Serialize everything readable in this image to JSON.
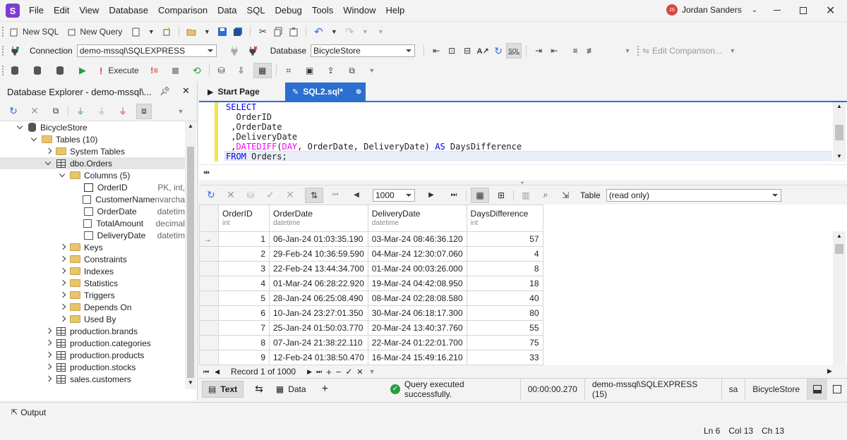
{
  "app": {
    "logo_letter": "S",
    "menu": [
      "File",
      "Edit",
      "View",
      "Database",
      "Comparison",
      "Data",
      "SQL",
      "Debug",
      "Tools",
      "Window",
      "Help"
    ],
    "user": {
      "initials": "JS",
      "name": "Jordan Sanders"
    },
    "accent": "#2c6fce",
    "brand": "#7e3dd1"
  },
  "toolbar": {
    "new_sql": "New SQL",
    "new_query": "New Query",
    "connection_label": "Connection",
    "connection_value": "demo-mssql\\SQLEXPRESS",
    "database_label": "Database",
    "database_value": "BicycleStore",
    "edit_comparison": "Edit Comparison...",
    "execute": "Execute"
  },
  "explorer": {
    "title": "Database Explorer - demo-mssql\\...",
    "tree": [
      {
        "label": "BicycleStore",
        "icon": "database-icon",
        "level": 0,
        "state": "e"
      },
      {
        "label": "Tables (10)",
        "icon": "folder-icon",
        "level": 1,
        "state": "e"
      },
      {
        "label": "System Tables",
        "icon": "folder-icon",
        "level": 2,
        "state": "c"
      },
      {
        "label": "dbo.Orders",
        "icon": "table-icon",
        "level": 2,
        "state": "e",
        "selected": true
      },
      {
        "label": "Columns (5)",
        "icon": "folder-icon",
        "level": 3,
        "state": "e"
      },
      {
        "label": "OrderID",
        "icon": "key-column-icon",
        "level": 4,
        "state": "",
        "type": "PK, int,"
      },
      {
        "label": "CustomerName",
        "icon": "column-icon",
        "level": 4,
        "state": "",
        "type": "nvarcha"
      },
      {
        "label": "OrderDate",
        "icon": "column-icon",
        "level": 4,
        "state": "",
        "type": "datetim"
      },
      {
        "label": "TotalAmount",
        "icon": "column-icon",
        "level": 4,
        "state": "",
        "type": "decimal"
      },
      {
        "label": "DeliveryDate",
        "icon": "column-icon",
        "level": 4,
        "state": "",
        "type": "datetim"
      },
      {
        "label": "Keys",
        "icon": "folder-icon",
        "level": 3,
        "state": "c"
      },
      {
        "label": "Constraints",
        "icon": "folder-icon",
        "level": 3,
        "state": "c"
      },
      {
        "label": "Indexes",
        "icon": "folder-icon",
        "level": 3,
        "state": "c"
      },
      {
        "label": "Statistics",
        "icon": "folder-icon",
        "level": 3,
        "state": "c"
      },
      {
        "label": "Triggers",
        "icon": "folder-icon",
        "level": 3,
        "state": "c"
      },
      {
        "label": "Depends On",
        "icon": "folder-icon",
        "level": 3,
        "state": "c"
      },
      {
        "label": "Used By",
        "icon": "folder-icon",
        "level": 3,
        "state": "c"
      },
      {
        "label": "production.brands",
        "icon": "table-icon",
        "level": 2,
        "state": "c"
      },
      {
        "label": "production.categories",
        "icon": "table-icon",
        "level": 2,
        "state": "c"
      },
      {
        "label": "production.products",
        "icon": "table-icon",
        "level": 2,
        "state": "c"
      },
      {
        "label": "production.stocks",
        "icon": "table-icon",
        "level": 2,
        "state": "c"
      },
      {
        "label": "sales.customers",
        "icon": "table-icon",
        "level": 2,
        "state": "c"
      }
    ]
  },
  "tabs": {
    "start_page": "Start Page",
    "sql_tab": "SQL2.sql*"
  },
  "editor": {
    "lines": [
      [
        {
          "t": "SELECT",
          "c": "kw"
        }
      ],
      [
        {
          "t": "  OrderID",
          "c": ""
        }
      ],
      [
        {
          "t": " ,OrderDate",
          "c": ""
        }
      ],
      [
        {
          "t": " ,DeliveryDate",
          "c": ""
        }
      ],
      [
        {
          "t": " ,",
          "c": ""
        },
        {
          "t": "DATEDIFF",
          "c": "fn"
        },
        {
          "t": "(",
          "c": ""
        },
        {
          "t": "DAY",
          "c": "fn"
        },
        {
          "t": ", OrderDate, DeliveryDate) ",
          "c": ""
        },
        {
          "t": "AS",
          "c": "kw"
        },
        {
          "t": " DaysDifference",
          "c": ""
        }
      ],
      [
        {
          "t": "FROM",
          "c": "kw"
        },
        {
          "t": " Orders;",
          "c": ""
        }
      ]
    ]
  },
  "results": {
    "page_size": "1000",
    "view_label": "Table",
    "view_value": "(read only)",
    "columns": [
      {
        "name": "OrderID",
        "type": "int"
      },
      {
        "name": "OrderDate",
        "type": "datetime"
      },
      {
        "name": "DeliveryDate",
        "type": "datetime"
      },
      {
        "name": "DaysDifference",
        "type": "int"
      }
    ],
    "rows": [
      [
        "1",
        "06-Jan-24 01:03:35.190",
        "03-Mar-24 08:46:36.120",
        "57"
      ],
      [
        "2",
        "29-Feb-24 10:36:59.590",
        "04-Mar-24 12:30:07.060",
        "4"
      ],
      [
        "3",
        "22-Feb-24 13:44:34.700",
        "01-Mar-24 00:03:26.000",
        "8"
      ],
      [
        "4",
        "01-Mar-24 06:28:22.920",
        "19-Mar-24 04:42:08.950",
        "18"
      ],
      [
        "5",
        "28-Jan-24 06:25:08.490",
        "08-Mar-24 02:28:08.580",
        "40"
      ],
      [
        "6",
        "10-Jan-24 23:27:01.350",
        "30-Mar-24 06:18:17.300",
        "80"
      ],
      [
        "7",
        "25-Jan-24 01:50:03.770",
        "20-Mar-24 13:40:37.760",
        "55"
      ],
      [
        "8",
        "07-Jan-24 21:38:22.110",
        "22-Mar-24 01:22:01.700",
        "75"
      ],
      [
        "9",
        "12-Feb-24 01:38:50.470",
        "16-Mar-24 15:49:16.210",
        "33"
      ]
    ],
    "record_nav": "Record 1 of 1000"
  },
  "bottom_tabs": {
    "text": "Text",
    "data": "Data"
  },
  "status": {
    "message": "Query executed successfully.",
    "time": "00:00:00.270",
    "server": "demo-mssql\\SQLEXPRESS (15)",
    "user": "sa",
    "database": "BicycleStore"
  },
  "output_label": "Output",
  "caret": {
    "ln": "Ln 6",
    "col": "Col 13",
    "ch": "Ch 13"
  }
}
